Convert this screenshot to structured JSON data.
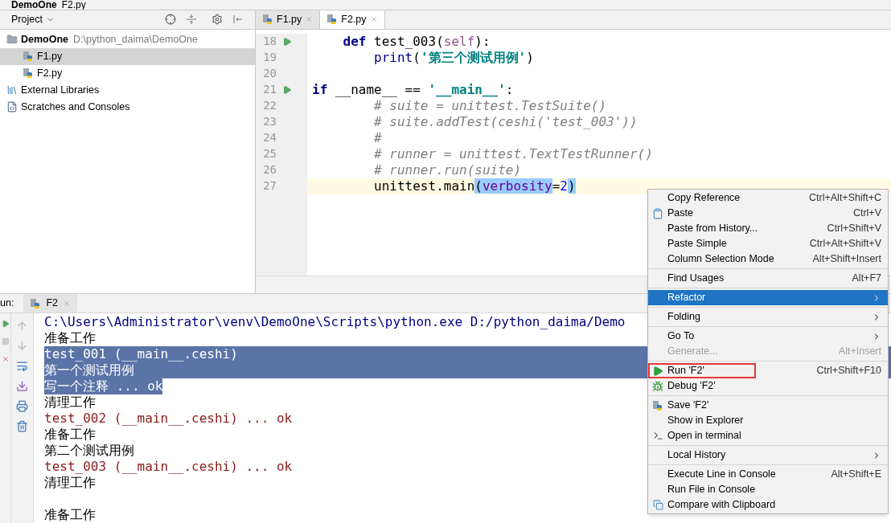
{
  "breadcrumb": [
    {
      "label": "DemoOne",
      "kind": "folder"
    },
    {
      "label": "F2.py",
      "kind": "python"
    }
  ],
  "project": {
    "title": "Project",
    "tree": [
      {
        "label": "DemoOne",
        "path": "D:\\python_daima\\DemoOne",
        "kind": "folder",
        "selected": false,
        "children": [
          {
            "label": "F1.py",
            "kind": "python",
            "selected": true
          },
          {
            "label": "F2.py",
            "kind": "python",
            "selected": false
          }
        ]
      },
      {
        "label": "External Libraries",
        "kind": "library",
        "selected": false
      },
      {
        "label": "Scratches and Consoles",
        "kind": "scratch",
        "selected": false
      }
    ]
  },
  "editor": {
    "tabs": [
      {
        "label": "F1.py",
        "selected": false
      },
      {
        "label": "F2.py",
        "selected": true
      }
    ],
    "lines": [
      {
        "number": "18",
        "run": true,
        "current": false,
        "tokens": [
          {
            "text": "    def",
            "kind": "keyword"
          },
          {
            "text": " test_003(",
            "kind": "plain"
          },
          {
            "text": "self",
            "kind": "self"
          },
          {
            "text": "):",
            "kind": "plain"
          }
        ]
      },
      {
        "number": "19",
        "run": false,
        "current": false,
        "tokens": [
          {
            "text": "        print",
            "kind": "builtin"
          },
          {
            "text": "(",
            "kind": "plain"
          },
          {
            "text": "'第三个测试用例'",
            "kind": "string"
          },
          {
            "text": ")",
            "kind": "plain"
          }
        ]
      },
      {
        "number": "20",
        "run": false,
        "current": false
      },
      {
        "number": "21",
        "run": true,
        "current": false,
        "tokens": [
          {
            "text": "if",
            "kind": "keyword"
          },
          {
            "text": " __name__ == ",
            "kind": "plain"
          },
          {
            "text": "'__main__'",
            "kind": "string"
          },
          {
            "text": ":",
            "kind": "plain"
          }
        ]
      },
      {
        "number": "22",
        "run": false,
        "current": false,
        "tokens": [
          {
            "text": "        # suite = unittest.TestSuite()",
            "kind": "comment"
          }
        ]
      },
      {
        "number": "23",
        "run": false,
        "current": false,
        "tokens": [
          {
            "text": "        # suite.addTest(ceshi('test_003'))",
            "kind": "comment"
          }
        ]
      },
      {
        "number": "24",
        "run": false,
        "current": false,
        "tokens": [
          {
            "text": "        #",
            "kind": "comment"
          }
        ]
      },
      {
        "number": "25",
        "run": false,
        "current": false,
        "tokens": [
          {
            "text": "        # runner = unittest.TextTestRunner()",
            "kind": "comment"
          }
        ]
      },
      {
        "number": "26",
        "run": false,
        "current": false,
        "tokens": [
          {
            "text": "        # runner.run(suite)",
            "kind": "comment"
          }
        ]
      },
      {
        "number": "27",
        "run": false,
        "current": true,
        "tokens": [
          {
            "text": "        unittest.main",
            "kind": "plain"
          },
          {
            "text": "(",
            "kind": "bracket"
          },
          {
            "text": "verbosity",
            "kind": "param"
          },
          {
            "text": "=",
            "kind": "plain"
          },
          {
            "text": "2",
            "kind": "number"
          },
          {
            "text": ")",
            "kind": "bracket"
          }
        ]
      }
    ]
  },
  "run_panel": {
    "title": "un:",
    "tab": "F2",
    "lines": [
      {
        "text": "C:\\Users\\Administrator\\venv\\DemoOne\\Scripts\\python.exe D:/python_daima/Demo",
        "kind": "command",
        "selected": false
      },
      {
        "text": "准备工作",
        "kind": "output",
        "selected": false
      },
      {
        "text": "test_001 (__main__.ceshi)",
        "kind": "output",
        "selected": true
      },
      {
        "text": "第一个测试用例",
        "kind": "output",
        "selected": true
      },
      {
        "text": "写一个注释 ... ok",
        "kind": "output",
        "selected": true
      },
      {
        "text": "清理工作",
        "kind": "output",
        "selected": false
      },
      {
        "text": "test_002 (__main__.ceshi) ... ok",
        "kind": "stderr",
        "selected": false
      },
      {
        "text": "准备工作",
        "kind": "output",
        "selected": false
      },
      {
        "text": "第二个测试用例",
        "kind": "output",
        "selected": false
      },
      {
        "text": "test_003 (__main__.ceshi) ... ok",
        "kind": "stderr",
        "selected": false
      },
      {
        "text": "清理工作",
        "kind": "output",
        "selected": false
      },
      {
        "kind": "blank"
      },
      {
        "text": "准备工作",
        "kind": "output",
        "selected": false
      }
    ]
  },
  "context_menu": {
    "groups": [
      [
        {
          "label": "Copy Reference",
          "shortcut": "Ctrl+Alt+Shift+C",
          "kind": "plain"
        },
        {
          "label": "Paste",
          "shortcut": "Ctrl+V",
          "kind": "clipboard"
        },
        {
          "label": "Paste from History...",
          "shortcut": "Ctrl+Shift+V",
          "kind": "plain"
        },
        {
          "label": "Paste Simple",
          "shortcut": "Ctrl+Alt+Shift+V",
          "kind": "plain"
        },
        {
          "label": "Column Selection Mode",
          "shortcut": "Alt+Shift+Insert",
          "kind": "plain"
        }
      ],
      [
        {
          "label": "Find Usages",
          "shortcut": "Alt+F7",
          "kind": "plain"
        }
      ],
      [
        {
          "label": "Refactor",
          "submenu": true,
          "selected": true,
          "kind": "plain"
        }
      ],
      [
        {
          "label": "Folding",
          "submenu": true,
          "kind": "plain"
        }
      ],
      [
        {
          "label": "Go To",
          "submenu": true,
          "kind": "plain"
        },
        {
          "label": "Generate...",
          "shortcut": "Alt+Insert",
          "disabled": true,
          "kind": "plain"
        }
      ],
      [
        {
          "label": "Run 'F2'",
          "shortcut": "Ctrl+Shift+F10",
          "kind": "run",
          "highlighted": true
        },
        {
          "label": "Debug 'F2'",
          "kind": "debug"
        }
      ],
      [
        {
          "label": "Save 'F2'",
          "kind": "python"
        },
        {
          "label": "Show in Explorer",
          "kind": "plain"
        },
        {
          "label": "Open in terminal",
          "kind": "terminal"
        }
      ],
      [
        {
          "label": "Local History",
          "submenu": true,
          "kind": "plain"
        }
      ],
      [
        {
          "label": "Execute Line in Console",
          "shortcut": "Alt+Shift+E",
          "kind": "plain"
        },
        {
          "label": "Run File in Console",
          "kind": "plain"
        },
        {
          "label": "Compare with Clipboard",
          "kind": "compare"
        }
      ]
    ]
  }
}
